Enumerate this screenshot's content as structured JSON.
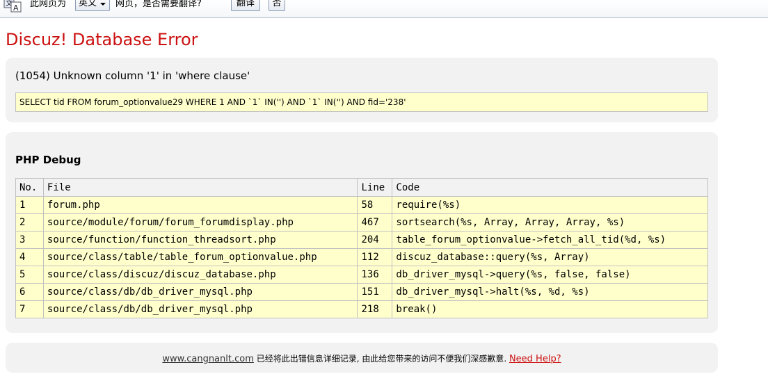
{
  "translate_bar": {
    "prefix": "此网页为",
    "language": "英文",
    "question": "网页，是否需要翻译?",
    "translate_button": "翻译",
    "no_button": "否"
  },
  "page_title": "Discuz! Database Error",
  "error": {
    "message": "(1054) Unknown column '1' in 'where clause'",
    "sql": "SELECT tid FROM forum_optionvalue29 WHERE 1 AND `1` IN('') AND `1` IN('') AND fid='238'"
  },
  "debug": {
    "title": "PHP Debug",
    "headers": [
      "No.",
      "File",
      "Line",
      "Code"
    ],
    "rows": [
      [
        "1",
        "forum.php",
        "58",
        "require(%s)"
      ],
      [
        "2",
        "source/module/forum/forum_forumdisplay.php",
        "467",
        "sortsearch(%s, Array, Array, Array, %s)"
      ],
      [
        "3",
        "source/function/function_threadsort.php",
        "204",
        "table_forum_optionvalue->fetch_all_tid(%d, %s)"
      ],
      [
        "4",
        "source/class/table/table_forum_optionvalue.php",
        "112",
        "discuz_database::query(%s, Array)"
      ],
      [
        "5",
        "source/class/discuz/discuz_database.php",
        "136",
        "db_driver_mysql->query(%s, false, false)"
      ],
      [
        "6",
        "source/class/db/db_driver_mysql.php",
        "151",
        "db_driver_mysql->halt(%s, %d, %s)"
      ],
      [
        "7",
        "source/class/db/db_driver_mysql.php",
        "218",
        "break()"
      ]
    ]
  },
  "footer": {
    "site": "www.cangnanlt.com",
    "text": " 已经将此出错信息详细记录, 由此给您带来的访问不便我们深感歉意. ",
    "help": "Need Help?"
  }
}
